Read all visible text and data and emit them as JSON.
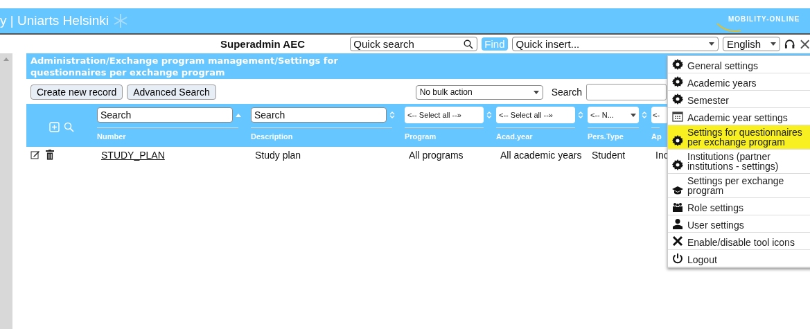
{
  "header": {
    "brand": "y | Uniarts Helsinki",
    "logo": "MOBILITY-ONLINE"
  },
  "toolbar": {
    "user": "Superadmin AEC",
    "quick_search": {
      "placeholder": "Quick search"
    },
    "find": "Find",
    "quick_insert": "Quick insert...",
    "language": "English"
  },
  "page_title": "Administration/Exchange program management/Settings for questionnaires per exchange program",
  "actions": {
    "buttons": [
      "Create new record",
      "Advanced Search"
    ],
    "bulk_action": "No bulk action",
    "search_label": "Search"
  },
  "table": {
    "columns": [
      {
        "label": "Number",
        "kind": "text",
        "filter": "Search",
        "sorted": true
      },
      {
        "label": "Description",
        "kind": "text",
        "filter": "Search",
        "sorted": false
      },
      {
        "label": "Program",
        "kind": "select",
        "filter": "<-- Select all --»",
        "sorted": false
      },
      {
        "label": "Acad.year",
        "kind": "select",
        "filter": "<-- Select all --»",
        "sorted": false
      },
      {
        "label": "Pers.Type",
        "kind": "select",
        "filter": "<-- N...",
        "sorted": false
      },
      {
        "label": "Ap",
        "kind": "select",
        "filter": "<-"
      }
    ],
    "rows": [
      {
        "cells": [
          "STUDY_PLAN",
          "Study plan",
          "All programs",
          "All academic years",
          "Student",
          "Inc"
        ]
      }
    ]
  },
  "menu": [
    {
      "label": "General settings",
      "kind": "gear",
      "selected": false
    },
    {
      "label": "Academic years",
      "kind": "gear",
      "selected": false
    },
    {
      "label": "Semester",
      "kind": "gear",
      "selected": false
    },
    {
      "label": "Academic year settings",
      "kind": "calendar",
      "selected": false
    },
    {
      "label": "Settings for questionnaires per exchange program",
      "kind": "gear",
      "selected": true
    },
    {
      "label": "Institutions (partner institutions - settings)",
      "kind": "gear",
      "selected": false
    },
    {
      "label": "Settings per exchange program",
      "kind": "cap",
      "selected": false
    },
    {
      "label": "Role settings",
      "kind": "people",
      "selected": false
    },
    {
      "label": "User settings",
      "kind": "user",
      "selected": false
    },
    {
      "label": "Enable/disable tool icons",
      "kind": "tools",
      "selected": false
    },
    {
      "label": "Logout",
      "kind": "power",
      "selected": false
    }
  ]
}
